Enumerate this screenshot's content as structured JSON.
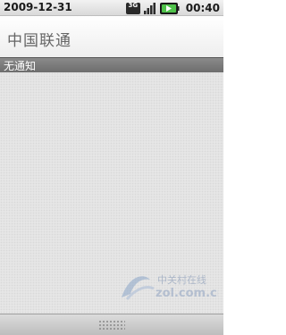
{
  "status_bar": {
    "date": "2009-12-31",
    "network": "3G",
    "time": "00:40",
    "icons": [
      "3g-icon",
      "signal-icon",
      "battery-icon"
    ]
  },
  "carrier": {
    "name": "中国联通"
  },
  "notifications": {
    "header": "无通知"
  },
  "watermark": {
    "text_cn": "中关村在线",
    "text_en": "zol.com.cn"
  },
  "colors": {
    "header_bg": "#777777",
    "content_bg": "#e6e6e6"
  }
}
